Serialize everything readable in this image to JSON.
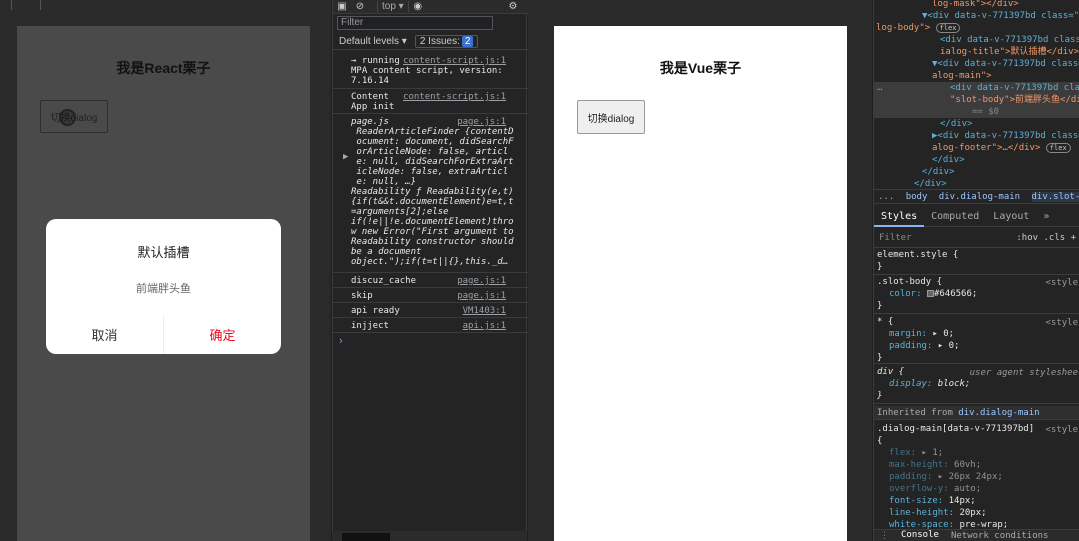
{
  "react": {
    "title": "我是React栗子",
    "toggle_label": "切换dialog",
    "dialog": {
      "title": "默认插槽",
      "body": "前端胖头鱼",
      "cancel": "取消",
      "confirm": "确定"
    }
  },
  "console": {
    "context": "top ▾",
    "filter_placeholder": "Filter",
    "levels": "Default levels ▾",
    "issues": "2 Issues:",
    "issues_count": "2",
    "logs": [
      {
        "msg": "→ running\nMPA content script, version:\n7.16.14",
        "src": "content-script.js:1"
      },
      {
        "msg": "Content\nApp init",
        "src": "content-script.js:1"
      },
      {
        "msg": "page.js\n ReaderArticleFinder {contentD\n ocument: document, didSearchF\n orArticleNode: false, articl\n e: null, didSearchForExtraArt\n icleNode: false, extraArticl\n e: null, …}\nReadability ƒ Readability(e,t)\n{if(t&&t.documentElement)e=t,t\n=arguments[2];else\nif(!e||!e.documentElement)thro\nw new Error(\"First argument to\nReadability constructor should\nbe a document\nobject.\");if(t=t||{},this._d…",
        "src": "page.js:1"
      },
      {
        "msg": "discuz_cache",
        "src": "page.js:1"
      },
      {
        "msg": "skip",
        "src": "page.js:1"
      },
      {
        "msg": "api ready",
        "src": "VM1403:1"
      },
      {
        "msg": "injject",
        "src": "api.js:1"
      }
    ],
    "prompt": "›"
  },
  "vue": {
    "title": "我是Vue栗子",
    "toggle_label": "切换dialog"
  },
  "elements": {
    "dom_lines": [
      "log-mask\"></div>",
      "▼<div data-v-771397bd class=\"d",
      "log-body\">",
      "<div data-v-771397bd class=",
      "ialog-title\">默认插槽</div>",
      "▼<div data-v-771397bd class=",
      "alog-main\">",
      "<div data-v-771397bd clas",
      "\"slot-body\">前端胖头鱼</div>",
      "== $0",
      "</div>",
      "▶<div data-v-771397bd class=",
      "alog-footer\">…</div>",
      "</div>",
      "</div>",
      "</div>"
    ],
    "flex_badge": "flex",
    "breadcrumb": [
      "...",
      "body",
      "div.dialog-main",
      "div.slot-body"
    ],
    "tabs": [
      "Styles",
      "Computed",
      "Layout",
      "»"
    ],
    "filter_placeholder": "Filter",
    "filter_tools": ":hov  .cls  +",
    "rules": {
      "element_style": "element.style {",
      "slot_body_selector": ".slot-body {",
      "slot_body_prop": "color:",
      "slot_body_val": "#646566;",
      "star_selector": "* {",
      "margin_prop": "margin:",
      "margin_val": "▸ 0;",
      "padding_prop": "padding:",
      "padding_val": "▸ 0;",
      "div_selector": "div {",
      "div_origin": "user agent styleshee",
      "display_prop": "display:",
      "display_val": "block;",
      "origin_style": "<style",
      "close": "}",
      "inherited_label": "Inherited from",
      "inherited_link": "div.dialog-main",
      "dialog_main_selector": ".dialog-main[data-v-771397bd]",
      "open_brace": "{",
      "dm_props": [
        [
          "flex:",
          "▸ 1;"
        ],
        [
          "max-height:",
          "60vh;"
        ],
        [
          "padding:",
          "▸ 26px 24px;"
        ],
        [
          "overflow-y:",
          "auto;"
        ],
        [
          "font-size:",
          "14px;"
        ],
        [
          "line-height:",
          "20px;"
        ],
        [
          "white-space:",
          "pre-wrap;"
        ]
      ]
    },
    "drawer_tabs": [
      "Console",
      "Network conditions"
    ],
    "colors": {
      "slot_color": "#646566",
      "confirm_red": "#ee0a24"
    }
  }
}
